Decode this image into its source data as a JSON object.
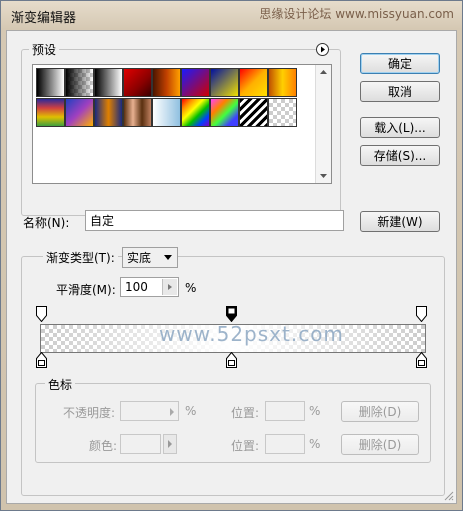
{
  "window": {
    "title": "渐变编辑器",
    "watermark_top": "思缘设计论坛 www.missyuan.com"
  },
  "buttons": {
    "ok": "确定",
    "cancel": "取消",
    "load": "载入(L)...",
    "save": "存储(S)...",
    "new": "新建(W)",
    "delete": "删除(D)"
  },
  "presets": {
    "label": "预设",
    "menu_icon": "circle-arrow-right-icon",
    "swatches_row1": [
      "linear-gradient(to right,#000,#fff)",
      "checker:linear-gradient(to right,rgba(0,0,0,1),rgba(0,0,0,0))",
      "linear-gradient(to right,#000,#fff)",
      "linear-gradient(135deg,#e00000,#8a0000 60%,#3a0000)",
      "linear-gradient(to right,#4b1500,#c04000,#ffa000)",
      "linear-gradient(135deg,#1a1aff,#d00000)",
      "linear-gradient(135deg,#0010a0,#f0e000)",
      "linear-gradient(135deg,#ff0000,#ffb000,#ffe000)",
      "linear-gradient(to right,#c05000,#ffd000,#ff8000)"
    ],
    "swatches_row2": [
      "linear-gradient(to bottom,#2a2a9a,#d04040,#e0c000,#40a040)",
      "linear-gradient(135deg,#2040c0,#a040c0,#ffb000)",
      "linear-gradient(to right,#1a2a80,#e08000,#1a2a80)",
      "linear-gradient(to right,#5a3010,#e8b090,#5a3010,#c08060)",
      "linear-gradient(to right,#ffffff,#90c0e0)",
      "linear-gradient(135deg,#ff0000,#ff9000,#ffff00,#00c000,#0040ff,#8000c0)",
      "linear-gradient(135deg,#ff40ff,#ff8000 30%,#40ff40 55%,#4040ff 80%)",
      "repeating-linear-gradient(135deg,#000 0 3px,#fff 3px 6px)",
      "checker:none"
    ]
  },
  "name": {
    "label": "名称(N):",
    "value": "自定"
  },
  "gradient": {
    "type_label": "渐变类型(T):",
    "type_value": "实底",
    "smooth_label": "平滑度(M):",
    "smooth_value": "100",
    "smooth_unit": "%",
    "watermark": "www.52psxt.com"
  },
  "color_stops": {
    "label": "色标",
    "opacity_label": "不透明度:",
    "percent": "%",
    "location_label": "位置:",
    "color_label": "颜色:"
  }
}
